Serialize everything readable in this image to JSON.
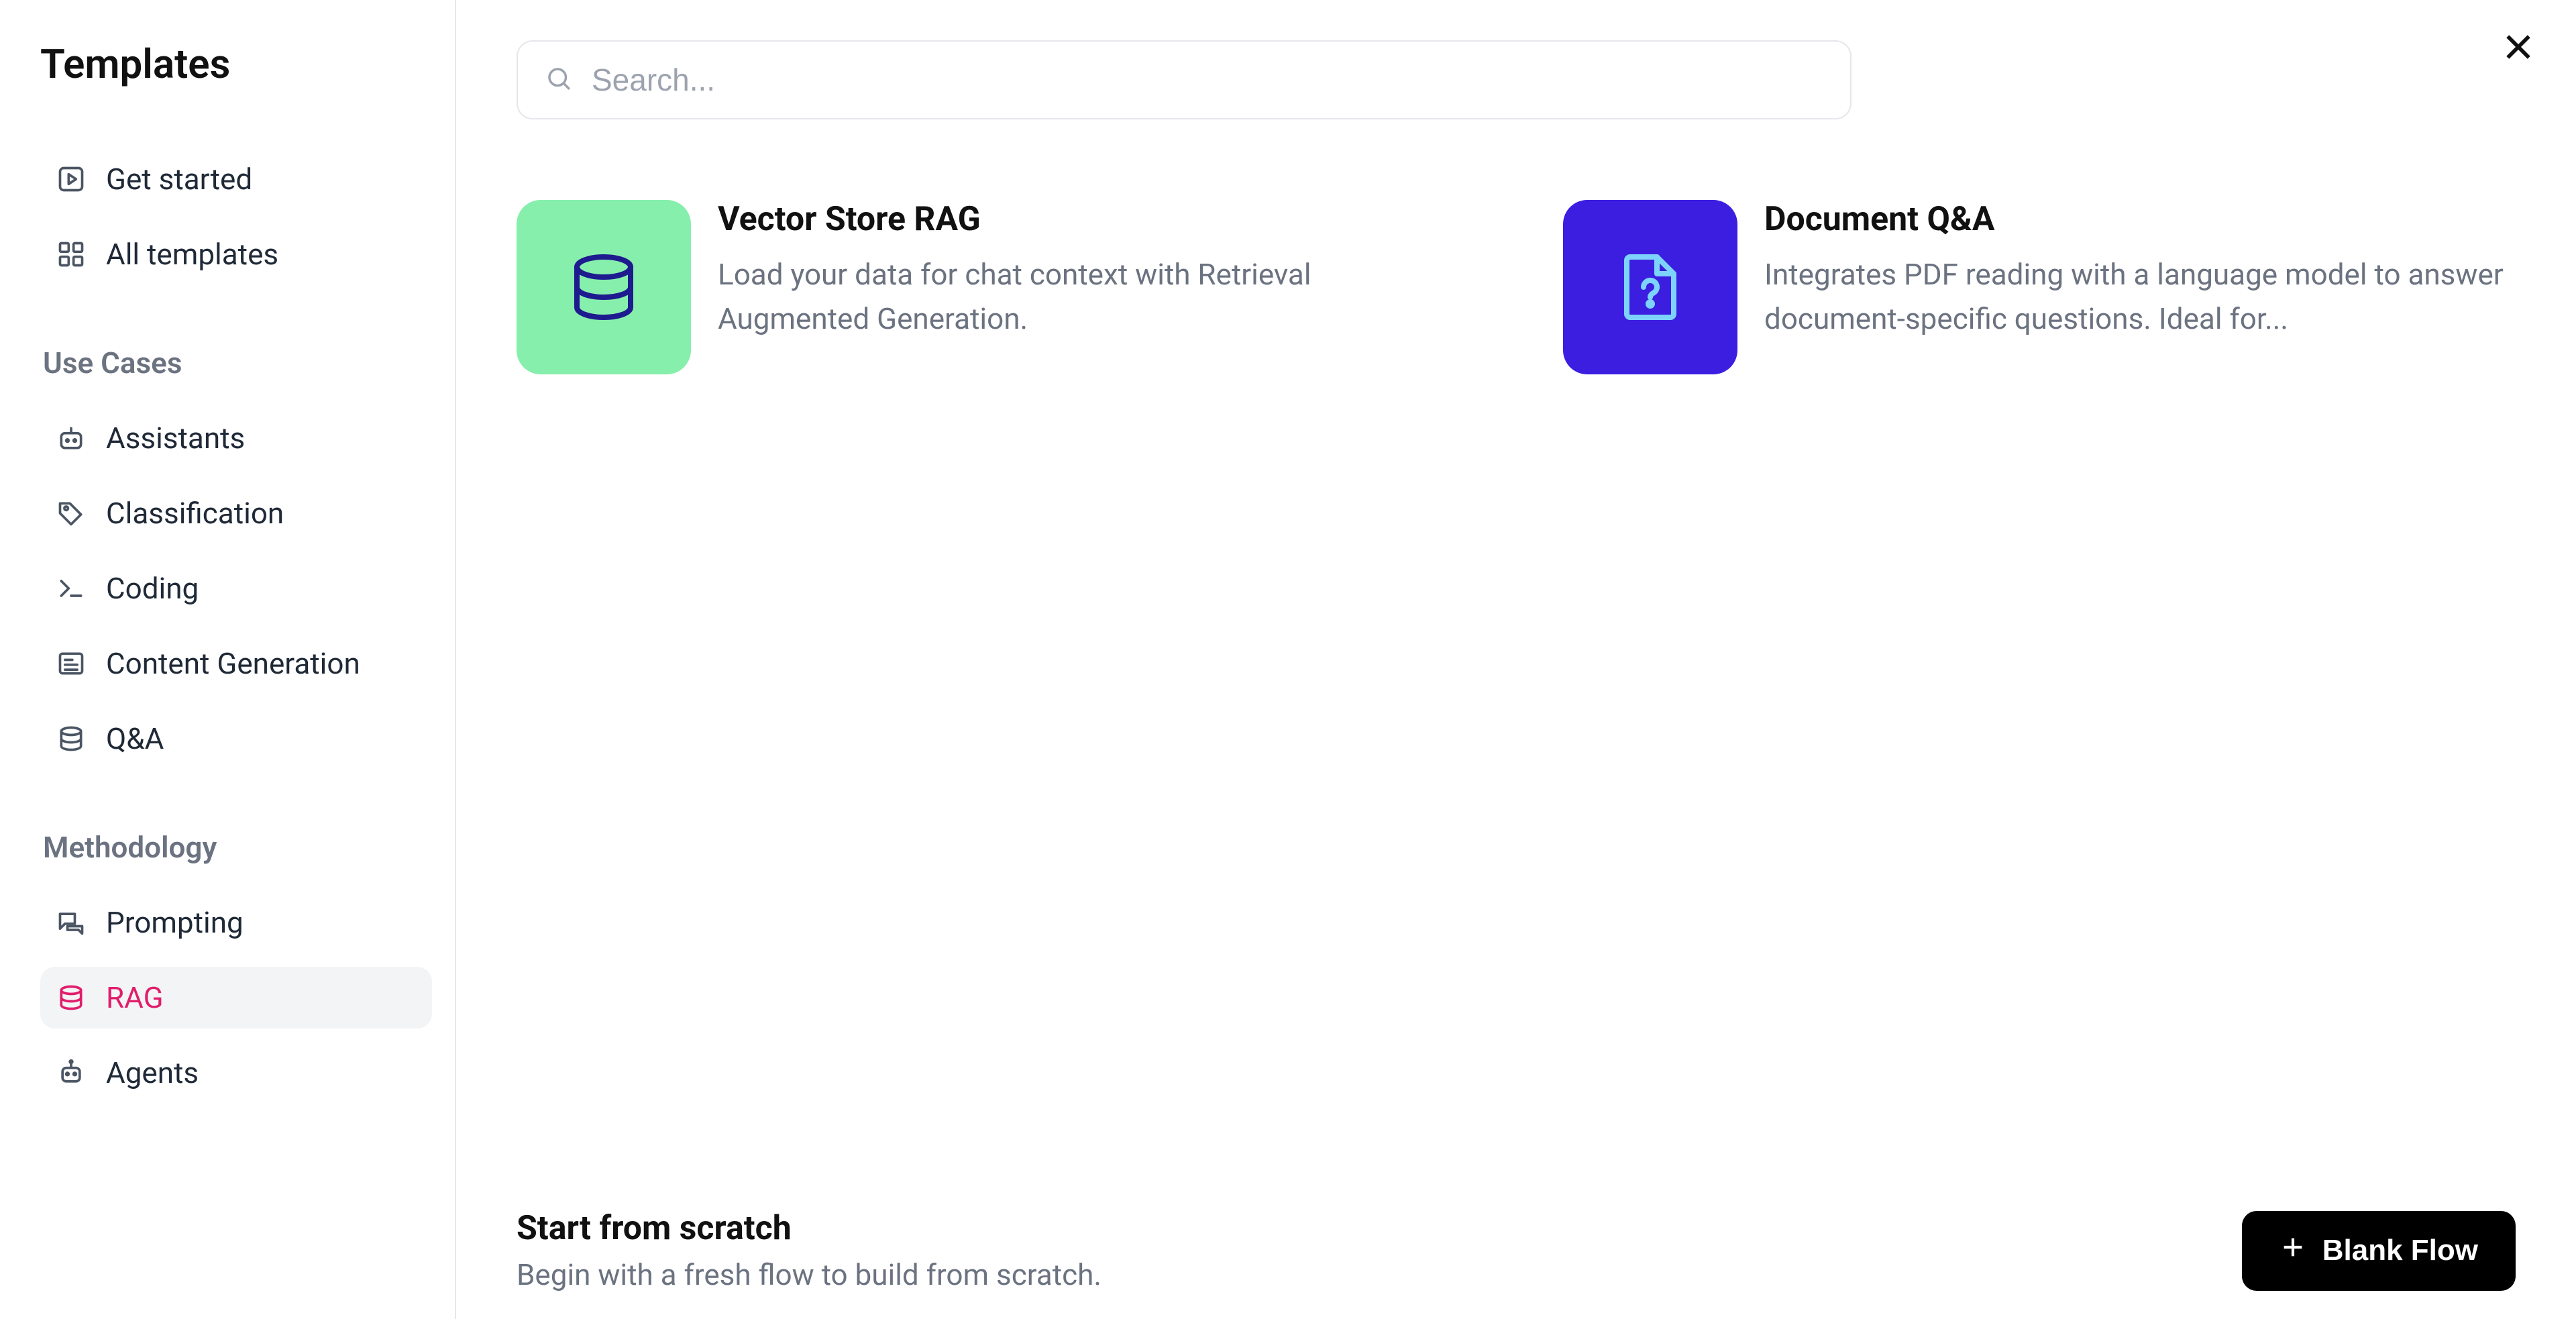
{
  "sidebar": {
    "title": "Templates",
    "top_items": [
      {
        "label": "Get started"
      },
      {
        "label": "All templates"
      }
    ],
    "groups": [
      {
        "title": "Use Cases",
        "items": [
          {
            "label": "Assistants"
          },
          {
            "label": "Classification"
          },
          {
            "label": "Coding"
          },
          {
            "label": "Content Generation"
          },
          {
            "label": "Q&A"
          }
        ]
      },
      {
        "title": "Methodology",
        "items": [
          {
            "label": "Prompting"
          },
          {
            "label": "RAG",
            "active": true
          },
          {
            "label": "Agents"
          }
        ]
      }
    ]
  },
  "search": {
    "placeholder": "Search..."
  },
  "cards": [
    {
      "title": "Vector Store RAG",
      "desc": "Load your data for chat context with Retrieval Augmented Generation."
    },
    {
      "title": "Document Q&A",
      "desc": "Integrates PDF reading with a language model to answer document-specific questions. Ideal for..."
    }
  ],
  "footer": {
    "title": "Start from scratch",
    "subtitle": "Begin with a fresh flow to build from scratch.",
    "button": "Blank Flow"
  }
}
